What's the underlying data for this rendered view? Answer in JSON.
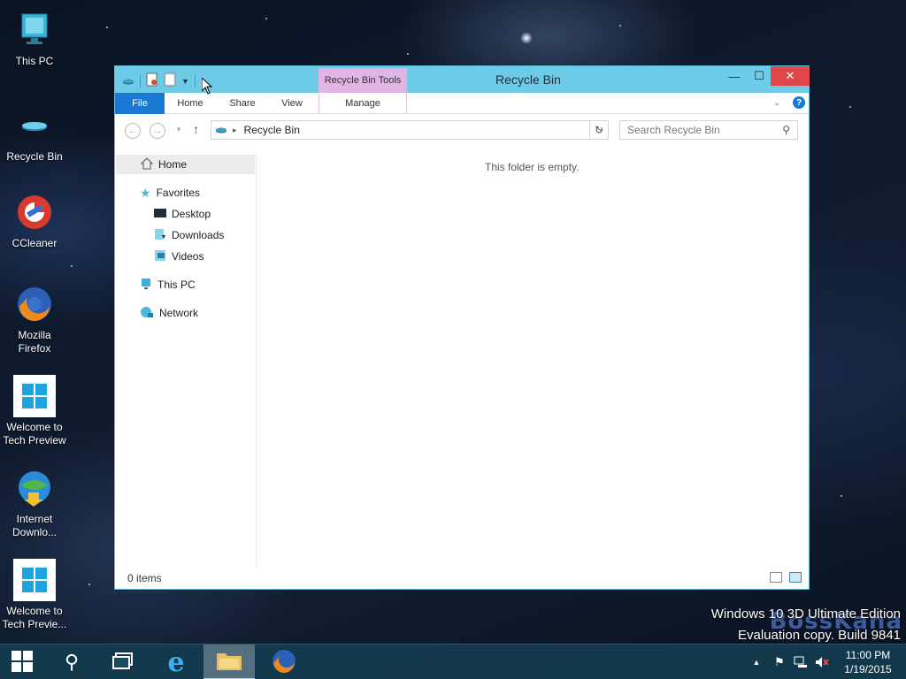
{
  "desktop": {
    "icons": [
      {
        "label": "This PC",
        "icon": "computer-icon"
      },
      {
        "label": "Recycle Bin",
        "icon": "recycle-bin-icon"
      },
      {
        "label": "CCleaner",
        "icon": "ccleaner-icon"
      },
      {
        "label": "Mozilla Firefox",
        "icon": "firefox-icon"
      },
      {
        "label": "Welcome to Tech Preview",
        "icon": "windows-logo-icon"
      },
      {
        "label": "Internet Downlo...",
        "icon": "idm-icon"
      },
      {
        "label": "Welcome to Tech Previe...",
        "icon": "windows-logo-icon"
      }
    ]
  },
  "explorer": {
    "title": "Recycle Bin",
    "contextual_tab": "Recycle Bin Tools",
    "ribbon_tabs": [
      "File",
      "Home",
      "Share",
      "View",
      "Manage"
    ],
    "address": "Recycle Bin",
    "search_placeholder": "Search Recycle Bin",
    "nav": {
      "home": "Home",
      "favorites": "Favorites",
      "desktop": "Desktop",
      "downloads": "Downloads",
      "videos": "Videos",
      "this_pc": "This PC",
      "network": "Network"
    },
    "empty_message": "This folder is empty.",
    "status": "0 items"
  },
  "watermark": {
    "edition": "Windows 10 3D Ultimate Edition",
    "build": "Evaluation copy. Build 9841",
    "logo": "BossKana"
  },
  "taskbar": {
    "time": "11:00 PM",
    "date": "1/19/2015"
  },
  "colors": {
    "titlebar": "#6dcbe8",
    "file_tab": "#1a7ad3",
    "contextual_tab": "#e2b4e6",
    "close_button": "#e0474b"
  }
}
